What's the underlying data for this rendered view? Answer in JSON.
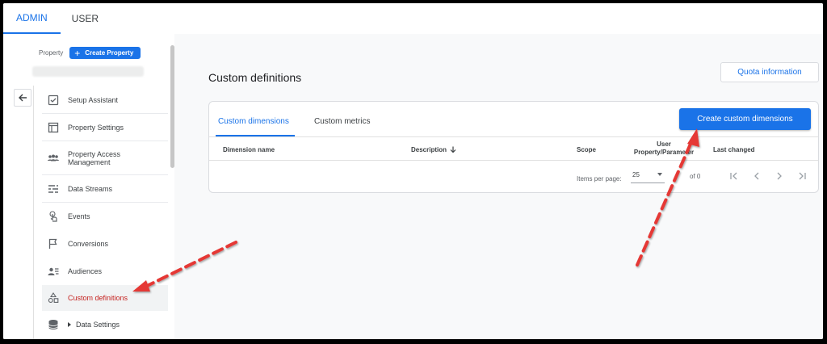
{
  "top_tabs": [
    {
      "label": "ADMIN",
      "active": true
    },
    {
      "label": "USER",
      "active": false
    }
  ],
  "sidebar": {
    "property_label": "Property",
    "create_property_label": "Create Property",
    "items": [
      {
        "label": "Setup Assistant",
        "icon": "checkbox-icon"
      },
      {
        "label": "Property Settings",
        "icon": "window-icon"
      },
      {
        "label": "Property Access Management",
        "icon": "people-icon"
      },
      {
        "label": "Data Streams",
        "icon": "streams-icon"
      },
      {
        "label": "Events",
        "icon": "touch-icon"
      },
      {
        "label": "Conversions",
        "icon": "flag-icon"
      },
      {
        "label": "Audiences",
        "icon": "audience-icon"
      },
      {
        "label": "Custom definitions",
        "icon": "shapes-icon",
        "active": true
      },
      {
        "label": "Data Settings",
        "icon": "database-icon"
      }
    ]
  },
  "main": {
    "title": "Custom definitions",
    "quota_button": "Quota information",
    "tabs": [
      {
        "label": "Custom dimensions",
        "active": true
      },
      {
        "label": "Custom metrics",
        "active": false
      }
    ],
    "create_button": "Create custom dimensions",
    "columns": {
      "name": "Dimension name",
      "description": "Description",
      "scope": "Scope",
      "user_property": "User Property/Parameter",
      "last_changed": "Last changed"
    },
    "pagination": {
      "items_per_page_label": "Items per page:",
      "items_per_page": "25",
      "range": "of 0"
    }
  },
  "colors": {
    "accent": "#1a73e8",
    "active_nav_text": "#c5221f",
    "annotation_arrow": "#e53935"
  }
}
